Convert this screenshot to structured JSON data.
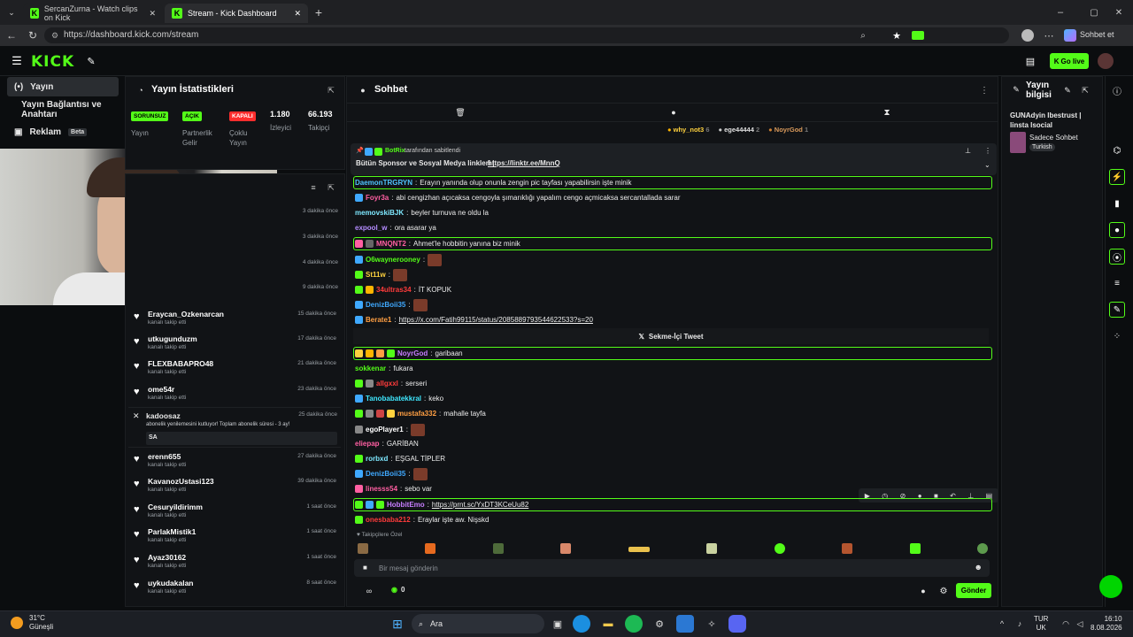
{
  "browser": {
    "tabs": [
      {
        "title": "SercanZurna - Watch clips on Kick",
        "icon": "kick-icon"
      },
      {
        "title": "Stream - Kick Dashboard",
        "icon": "kick-icon"
      }
    ],
    "url": "https://dashboard.kick.com/stream",
    "profile_label": "Sohbet et"
  },
  "header": {
    "logo": "KICK",
    "go_live": "Go live"
  },
  "nav": {
    "items": [
      {
        "label": "Yayın"
      },
      {
        "label": "Yayın Bağlantısı ve Anahtarı"
      },
      {
        "label": "Reklam",
        "badge": "Beta"
      }
    ]
  },
  "stats": {
    "title": "Yayın İstatistikleri",
    "items": [
      {
        "badge": "SORUNSUZ",
        "label": "Yayın",
        "color": "#53fc18"
      },
      {
        "badge": "AÇIK",
        "label": "Partnerlik Gelir",
        "color": "#53fc18"
      },
      {
        "badge": "KAPALI",
        "label": "Çoklu Yayın",
        "color": "#ff2d2d"
      }
    ],
    "viewers_value": "1.180",
    "viewers_label": "İzleyici",
    "followers_value": "66.193",
    "followers_label": "Takipçi"
  },
  "activity": {
    "times_top": [
      "3 dakika önce",
      "3 dakika önce",
      "4 dakika önce",
      "9 dakika önce"
    ],
    "items": [
      {
        "name": "Eraycan_Ozkenarcan",
        "sub": "kanalı takip etti",
        "time": "15 dakika önce"
      },
      {
        "name": "utkugunduzm",
        "sub": "kanalı takip etti",
        "time": "17 dakika önce"
      },
      {
        "name": "FLEXBABAPRO48",
        "sub": "kanalı takip etti",
        "time": "21 dakika önce"
      },
      {
        "name": "ome54r",
        "sub": "kanalı takip etti",
        "time": "23 dakika önce"
      }
    ],
    "sub_event": {
      "name": "kadoosaz",
      "time": "25 dakika önce",
      "text": "abonelik yenilemesini kutluyor! Toplam abonelik süresi - 3 ay!",
      "message": "SA"
    },
    "items2": [
      {
        "name": "erenn655",
        "sub": "kanalı takip etti",
        "time": "27 dakika önce"
      },
      {
        "name": "KavanozUstasi123",
        "sub": "kanalı takip etti",
        "time": "39 dakika önce"
      },
      {
        "name": "Cesuryildirimm",
        "sub": "kanalı takip etti",
        "time": "1 saat önce"
      },
      {
        "name": "ParlakMistik1",
        "sub": "kanalı takip etti",
        "time": "1 saat önce"
      },
      {
        "name": "Ayaz30162",
        "sub": "kanalı takip etti",
        "time": "1 saat önce"
      },
      {
        "name": "uykudakalan",
        "sub": "kanalı takip etti",
        "time": "8 saat önce"
      }
    ]
  },
  "chat": {
    "title": "Sohbet",
    "top_gifters": [
      {
        "name": "why_not3",
        "count": "6"
      },
      {
        "name": "ege44444",
        "count": "2"
      },
      {
        "name": "NoyrGod",
        "count": "1"
      }
    ],
    "pinned": {
      "by": "BotRix",
      "by_suffix": "tarafından sabitlendi",
      "text": "Bütün Sponsor ve Sosyal Medya linkleri |",
      "link": "https://linktr.ee/MnnQ"
    },
    "messages": [
      {
        "user": "DaemonTRGRYN",
        "color": "#4fc3ff",
        "text": "Erayın yanında olup onunla zengin pic tayfası yapabilirsin işte minik",
        "hl": true
      },
      {
        "user": "Foyr3a",
        "color": "#ff5fa2",
        "text": "abi cengizhan açıcaksa cengoyla şımarıklığı yapalım cengo açmicaksa sercantallada sarar"
      },
      {
        "user": "memovskiBJK",
        "color": "#7ee8ff",
        "text": "beyler turnuva ne oldu la"
      },
      {
        "user": "expool_w",
        "color": "#b48cff",
        "text": "ora asarar ya"
      },
      {
        "user": "MNQNT2",
        "color": "#ff5fa2",
        "text": "Ahmet'le hobbitin yanına biz minik",
        "hl": true
      },
      {
        "user": "O6waynerooney",
        "color": "#53fc18",
        "text": ""
      },
      {
        "user": "St11w",
        "color": "#ffd23f",
        "text": ""
      },
      {
        "user": "34ultras34",
        "color": "#ff3b3b",
        "text": "İT KOPUK"
      },
      {
        "user": "DenizBoii35",
        "color": "#3fa9ff",
        "text": ""
      },
      {
        "user": "Berate1",
        "color": "#ff9f43",
        "text": "",
        "link": "https://x.com/Fatih99115/status/2085889793544622533?s=20"
      }
    ],
    "tweet_label": "Sekme-İçi Tweet",
    "messages2": [
      {
        "user": "NoyrGod",
        "color": "#c77dff",
        "text": "garibaan",
        "hl": true
      },
      {
        "user": "sokkenar",
        "color": "#53fc18",
        "text": "fukara"
      },
      {
        "user": "allgxxl",
        "color": "#ff3b3b",
        "text": "serseri"
      },
      {
        "user": "Tanobabatekkral",
        "color": "#3fe8ff",
        "text": "keko"
      },
      {
        "user": "mustafa332",
        "color": "#ff9f43",
        "text": "mahalle tayfa"
      },
      {
        "user": "egoPlayer1",
        "color": "#ffffff",
        "text": ""
      },
      {
        "user": "eliepap",
        "color": "#ff5fa2",
        "text": "GARİBAN"
      },
      {
        "user": "rorbxd",
        "color": "#7ee8ff",
        "text": "EŞGAL TİPLER"
      },
      {
        "user": "DenizBoii35",
        "color": "#3fa9ff",
        "text": ""
      },
      {
        "user": "linesss54",
        "color": "#ff5fa2",
        "text": "sebo var"
      },
      {
        "user": "HobbitEmo",
        "color": "#c77dff",
        "text": "",
        "link": "https://prnt.sc/YxDT3KCeUu82",
        "hl": true
      },
      {
        "user": "onesbaba212",
        "color": "#ff3b3b",
        "text": "Eraylar işte aw. Nişskd"
      }
    ],
    "emote_section_label": "Takipçilere Özel",
    "input_placeholder": "Bir mesaj gönderin",
    "points": "0",
    "send_label": "Gönder"
  },
  "info": {
    "title": "Yayın bilgisi",
    "stream_title": "GUNAdyin Ibestrust | linsta Isocial",
    "category": "Sadece Sohbet",
    "tag": "Turkish"
  },
  "taskbar": {
    "weather_temp": "31°C",
    "weather_desc": "Güneşli",
    "search_label": "Ara",
    "lang": "TUR",
    "lang_sub": "UK",
    "time": "16:10",
    "date": "8.08.2026"
  }
}
